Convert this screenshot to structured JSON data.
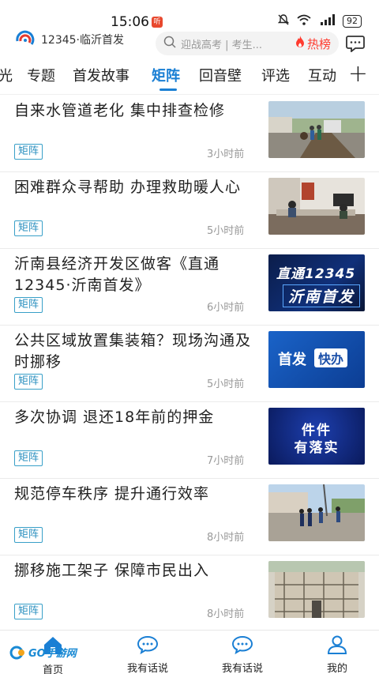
{
  "status": {
    "time": "15:06",
    "notif_badge": "听",
    "battery": "92"
  },
  "header": {
    "logo_text": "12345·临沂首发",
    "search_placeholder": "迎战高考 | 考生...",
    "hot_label": "热榜"
  },
  "tabs": [
    {
      "label": "光",
      "active": false
    },
    {
      "label": "专题",
      "active": false
    },
    {
      "label": "首发故事",
      "active": false
    },
    {
      "label": "矩阵",
      "active": true
    },
    {
      "label": "回音壁",
      "active": false
    },
    {
      "label": "评选",
      "active": false
    },
    {
      "label": "互动",
      "active": false
    }
  ],
  "tab_add": "+",
  "news": [
    {
      "title": "自来水管道老化  集中排查检修",
      "tag": "矩阵",
      "time": "3小时前",
      "thumb": "street-repair-photo"
    },
    {
      "title": "困难群众寻帮助    办理救助暖人心",
      "tag": "矩阵",
      "time": "5小时前",
      "thumb": "office-photo"
    },
    {
      "title": "沂南县经济开发区做客《直通12345·沂南首发》",
      "tag": "矩阵",
      "time": "6小时前",
      "thumb": "tv-program-banner",
      "thumb_line1": "直通12345",
      "thumb_line2": "沂南首发"
    },
    {
      "title": "公共区域放置集装箱？现场沟通及时挪移",
      "tag": "矩阵",
      "time": "5小时前",
      "thumb": "kuaiban-banner",
      "thumb_line1": "首发",
      "thumb_line2": "快办"
    },
    {
      "title": "多次协调  退还18年前的押金",
      "tag": "矩阵",
      "time": "7小时前",
      "thumb": "jianjian-banner",
      "thumb_line1": "件件",
      "thumb_line2": "有落实"
    },
    {
      "title": "规范停车秩序  提升通行效率",
      "tag": "矩阵",
      "time": "8小时前",
      "thumb": "street-officers-photo"
    },
    {
      "title": "挪移施工架子  保障市民出入",
      "tag": "矩阵",
      "time": "8小时前",
      "thumb": "scaffold-photo"
    }
  ],
  "nav": [
    {
      "label": "首页"
    },
    {
      "label": "我有话说"
    },
    {
      "label": "我有话说"
    },
    {
      "label": "我的"
    }
  ],
  "watermark": "GO手游网",
  "colors": {
    "accent": "#1a7fd4",
    "hot": "#ff3b2f",
    "tag": "#2a8fbf"
  }
}
